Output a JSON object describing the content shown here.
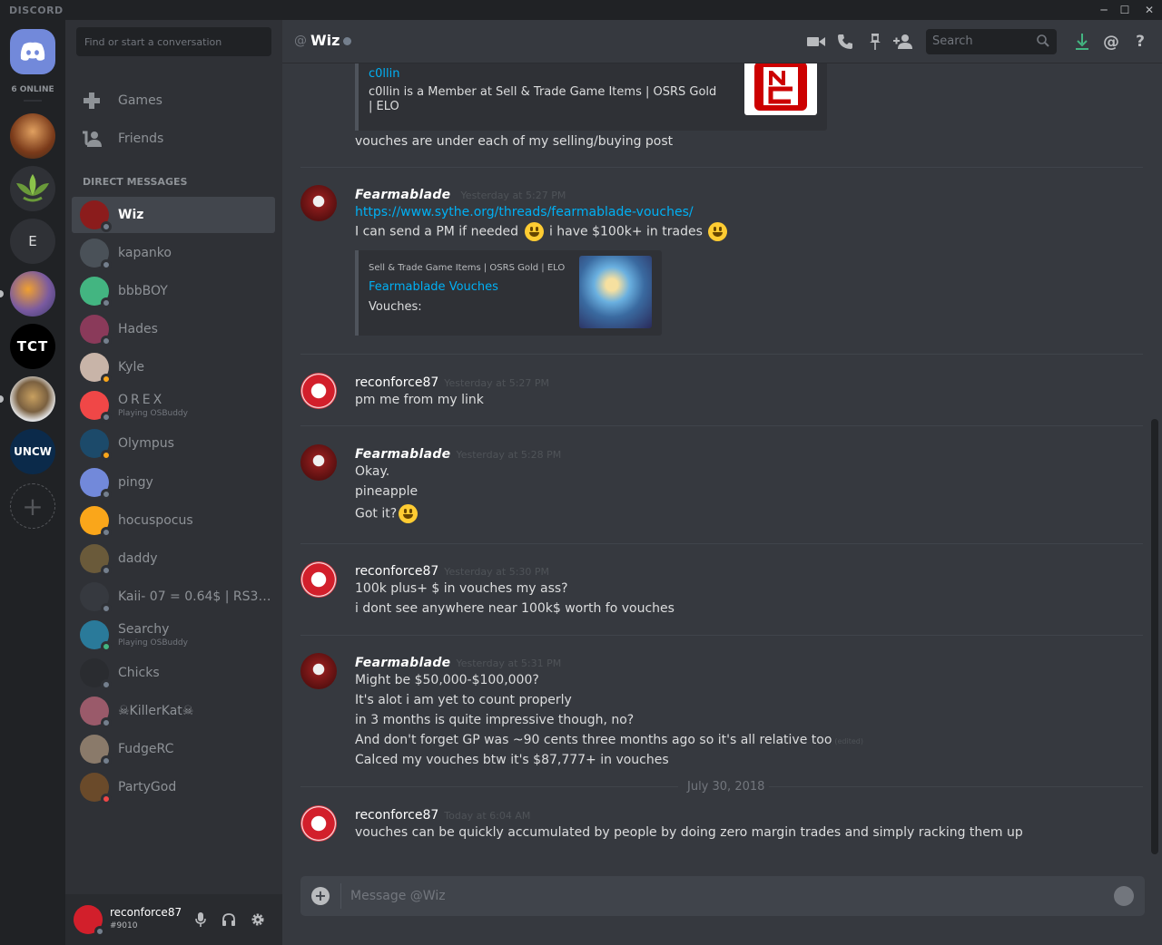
{
  "window": {
    "brand": "DISCORD",
    "minimize": "─",
    "maximize": "☐",
    "close": "✕"
  },
  "guilds": {
    "online_count": "6 ONLINE",
    "letter_guild": "E",
    "tct_label": "TCT",
    "uncw_label": "UNCW",
    "add_symbol": "+"
  },
  "sidebar": {
    "search_placeholder": "Find or start a conversation",
    "nav": [
      {
        "label": "Games",
        "icon": "controller-icon"
      },
      {
        "label": "Friends",
        "icon": "friends-icon"
      }
    ],
    "dm_header": "DIRECT MESSAGES",
    "dms": [
      {
        "name": "Wiz",
        "status": "offline",
        "sub": "",
        "avatar": "#8b1c1c"
      },
      {
        "name": "kapanko",
        "status": "offline",
        "sub": "",
        "avatar": "#4a5158"
      },
      {
        "name": "bbbBOY",
        "status": "offline",
        "sub": "",
        "avatar": "#43b581"
      },
      {
        "name": "Hades",
        "status": "offline",
        "sub": "",
        "avatar": "#8a3a5a"
      },
      {
        "name": "Kyle",
        "status": "idle",
        "sub": "",
        "avatar": "#c8b4a8"
      },
      {
        "name": "OREX",
        "status": "offline",
        "sub": "Playing OSBuddy",
        "avatar": "#f04747"
      },
      {
        "name": "Olympus",
        "status": "idle",
        "sub": "",
        "avatar": "#1c4a6a"
      },
      {
        "name": "pingy",
        "status": "offline",
        "sub": "",
        "avatar": "#7289da"
      },
      {
        "name": "hocuspocus",
        "status": "offline",
        "sub": "",
        "avatar": "#faa61a"
      },
      {
        "name": "daddy",
        "status": "offline",
        "sub": "",
        "avatar": "#6a5a3a"
      },
      {
        "name": "Kaii- 07 = 0.64$ | RS3 =...",
        "status": "offline",
        "sub": "",
        "avatar": "#36393f"
      },
      {
        "name": "Searchy",
        "status": "online",
        "sub": "Playing OSBuddy",
        "avatar": "#2a7a9a"
      },
      {
        "name": "Chicks",
        "status": "offline",
        "sub": "",
        "avatar": "#2a2c30"
      },
      {
        "name": "☠KillerKat☠",
        "status": "offline",
        "sub": "",
        "avatar": "#9a5a6a"
      },
      {
        "name": "FudgeRC",
        "status": "offline",
        "sub": "",
        "avatar": "#8a7a6a"
      },
      {
        "name": "PartyGod",
        "status": "dnd",
        "sub": "",
        "avatar": "#6a4a2a"
      }
    ]
  },
  "user": {
    "name": "reconforce87",
    "tag": "#9010"
  },
  "header": {
    "at": "@",
    "title": "Wiz",
    "search_placeholder": "Search"
  },
  "messages": {
    "embed1": {
      "title": "c0llin",
      "desc": "c0llin is a Member at Sell & Trade Game Items | OSRS Gold | ELO"
    },
    "orphan_line": "vouches are under each of my selling/buying post",
    "groups": [
      {
        "author": "Fearmablade",
        "time": "Yesterday at 5:27 PM",
        "link": "https://www.sythe.org/threads/fearmablade-vouches/",
        "line_a": "I can send a PM if needed",
        "line_b": "i have $100k+ in trades",
        "embed": {
          "provider": "Sell & Trade Game Items | OSRS Gold | ELO",
          "title": "Fearmablade Vouches",
          "desc": "Vouches:"
        }
      },
      {
        "author": "reconforce87",
        "time": "Yesterday at 5:27 PM",
        "lines": [
          "pm me from my link"
        ]
      },
      {
        "author": "Fearmablade",
        "time": "Yesterday at 5:28 PM",
        "lines": [
          "Okay.",
          "pineapple",
          "Got it?"
        ]
      },
      {
        "author": "reconforce87",
        "time": "Yesterday at 5:30 PM",
        "lines": [
          "100k plus+ $ in vouches my ass?",
          "i dont see anywhere near 100k$ worth fo vouches"
        ]
      },
      {
        "author": "Fearmablade",
        "time": "Yesterday at 5:31 PM",
        "lines": [
          "Might be $50,000-$100,000?",
          "It's alot i am yet to count properly",
          "in 3 months is quite impressive though, no?",
          "And don't forget GP was ~90 cents three months ago so it's all relative too",
          "Calced my vouches btw it's $87,777+ in vouches"
        ],
        "edited": "(edited)"
      },
      {
        "author": "reconforce87",
        "time": "Today at 6:04 AM",
        "lines": [
          "vouches can be quickly accumulated by people by doing zero margin trades and simply racking them up"
        ]
      }
    ],
    "date_separator": "July 30, 2018"
  },
  "composer": {
    "placeholder": "Message @Wiz"
  },
  "colors": {
    "accent": "#7289da",
    "link": "#00b0f4",
    "online": "#43b581",
    "idle": "#faa61a",
    "dnd": "#f04747"
  }
}
